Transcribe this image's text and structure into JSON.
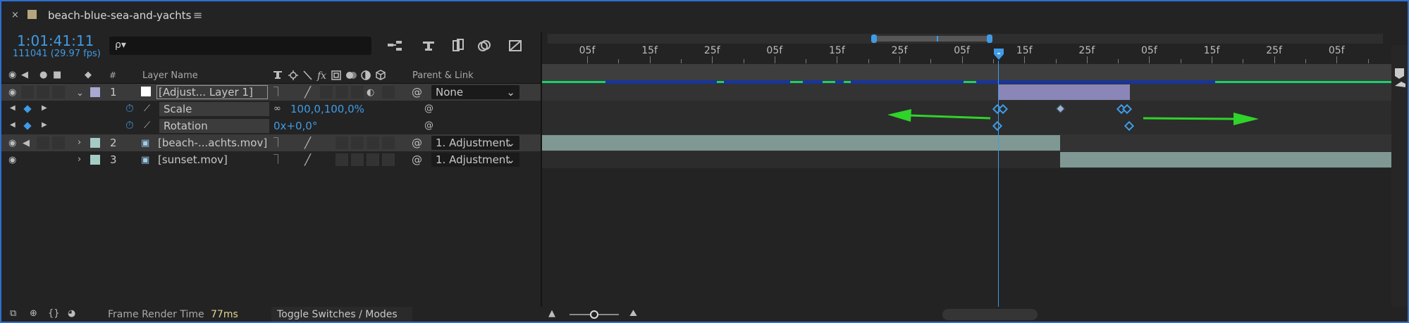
{
  "tab": {
    "title": "beach-blue-sea-and-yachts",
    "close": "×",
    "menu": "≡"
  },
  "timecode": "1:01:41:11",
  "frame_info": "111041 (29.97 fps)",
  "search": {
    "placeholder": "",
    "icon": "ρ▾"
  },
  "columns": {
    "hash": "#",
    "layer_name": "Layer Name",
    "parent_link": "Parent & Link"
  },
  "layers": [
    {
      "index": "1",
      "name": "[Adjust... Layer 1]",
      "parent": "None"
    },
    {
      "index": "2",
      "name": "[beach-...achts.mov]",
      "parent": "1. Adjustment"
    },
    {
      "index": "3",
      "name": "[sunset.mov]",
      "parent": "1. Adjustment"
    }
  ],
  "properties": [
    {
      "name": "Scale",
      "value": "100,0,100,0%"
    },
    {
      "name": "Rotation",
      "value": "0x+0,0°"
    }
  ],
  "ruler": [
    "05f",
    "15f",
    "25f",
    "05f",
    "15f",
    "25f",
    "05f",
    "15f",
    "25f",
    "05f",
    "15f",
    "25f",
    "05f"
  ],
  "status": {
    "label": "Frame Render Time",
    "value": "77ms",
    "toggle": "Toggle Switches / Modes"
  },
  "colors": {
    "accent": "#3f9be6",
    "green": "#2fd32a",
    "label_lavender": "#a8a8d2",
    "label_teal": "#a5ccc4",
    "adj_bar": "#8b86b8",
    "clip_bar": "#7f9893"
  },
  "playhead_percent": 54.5,
  "zoom_slider_percent": 50
}
